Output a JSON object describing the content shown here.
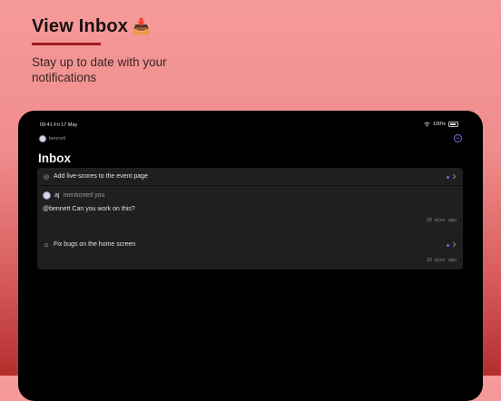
{
  "hero": {
    "title": "View Inbox",
    "emoji": "📥",
    "subtitle": "Stay up to date with your notifications"
  },
  "status_bar": {
    "time": "09:41  Fri 17 May",
    "battery": "100%"
  },
  "user": {
    "name": "bennett"
  },
  "page": {
    "title": "Inbox"
  },
  "notifications": [
    {
      "title": "Add live-scores to the event page",
      "icon": "comment-icon",
      "author": "aj",
      "action": "mentioned you",
      "comment": "@bennett Can you work on this?",
      "time": "30 mins ago",
      "unread": true
    },
    {
      "title": "Fix bugs on the home screen",
      "icon": "bell-icon",
      "time": "33 mins ago",
      "unread": true
    }
  ],
  "colors": {
    "accent": "#6d63e8",
    "background_top": "#f59a9a",
    "background_bottom": "#b52e2e",
    "device": "#000000",
    "card": "#1f1f1f"
  }
}
